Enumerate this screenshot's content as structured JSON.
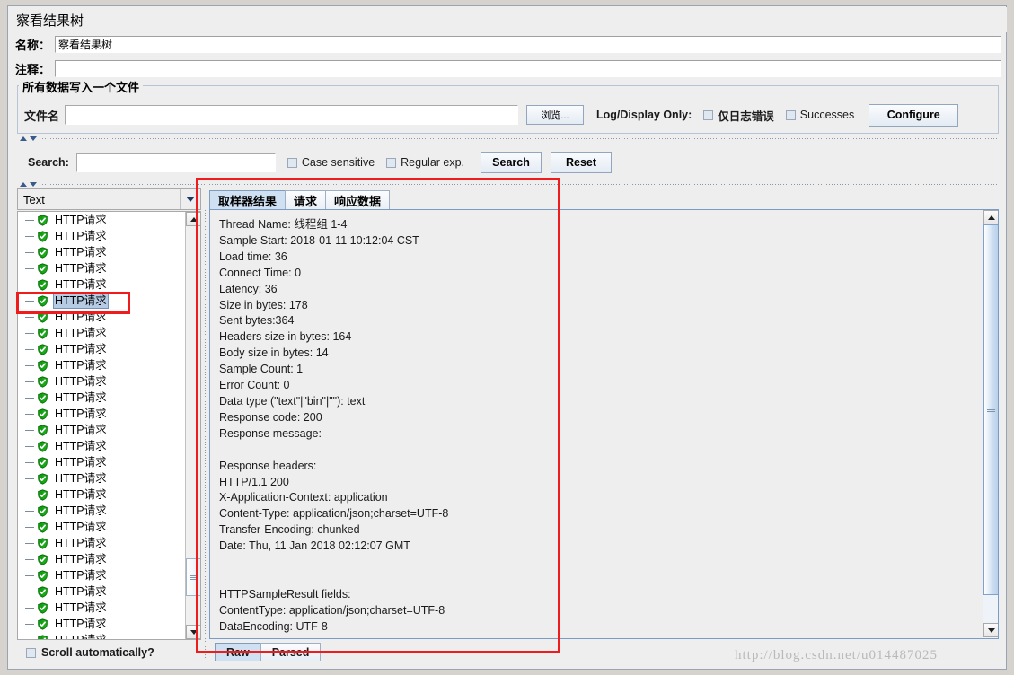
{
  "window": {
    "title": "察看结果树"
  },
  "fields": {
    "name_label": "名称：",
    "name_value": "察看结果树",
    "comment_label": "注释：",
    "comment_value": ""
  },
  "file_group": {
    "legend": "所有数据写入一个文件",
    "filename_label": "文件名",
    "filename_value": "",
    "browse_label": "浏览...",
    "log_display_label": "Log/Display Only:",
    "errors_only_label": "仅日志错误",
    "errors_only_checked": false,
    "successes_label": "Successes",
    "successes_checked": false,
    "configure_label": "Configure"
  },
  "search": {
    "label": "Search:",
    "value": "",
    "case_sensitive_label": "Case sensitive",
    "case_sensitive_checked": false,
    "regex_label": "Regular exp.",
    "regex_checked": false,
    "search_button": "Search",
    "reset_button": "Reset"
  },
  "tree": {
    "renderer_selected": "Text",
    "renderer_options": [
      "Text"
    ],
    "item_label": "HTTP请求",
    "item_icon": "green-shield-check-icon",
    "item_count": 27,
    "selected_index": 5,
    "scroll_auto_label": "Scroll automatically?",
    "scroll_auto_checked": false
  },
  "result_tabs": {
    "tabs": [
      "取样器结果",
      "请求",
      "响应数据"
    ],
    "active_index": 0
  },
  "bottom_tabs": {
    "tabs": [
      "Raw",
      "Parsed"
    ],
    "active_index": 0
  },
  "sampler_result": "Thread Name: 线程组 1-4\nSample Start: 2018-01-11 10:12:04 CST\nLoad time: 36\nConnect Time: 0\nLatency: 36\nSize in bytes: 178\nSent bytes:364\nHeaders size in bytes: 164\nBody size in bytes: 14\nSample Count: 1\nError Count: 0\nData type (\"text\"|\"bin\"|\"\"): text\nResponse code: 200\nResponse message:\n\nResponse headers:\nHTTP/1.1 200\nX-Application-Context: application\nContent-Type: application/json;charset=UTF-8\nTransfer-Encoding: chunked\nDate: Thu, 11 Jan 2018 02:12:07 GMT\n\n\nHTTPSampleResult fields:\nContentType: application/json;charset=UTF-8\nDataEncoding: UTF-8",
  "watermark": "http://blog.csdn.net/u014487025",
  "colors": {
    "annotation": "#ee1c1c",
    "selection": "#b5cbe3",
    "active_tab": "#cfe0f2",
    "icon_green": "#10a010"
  }
}
